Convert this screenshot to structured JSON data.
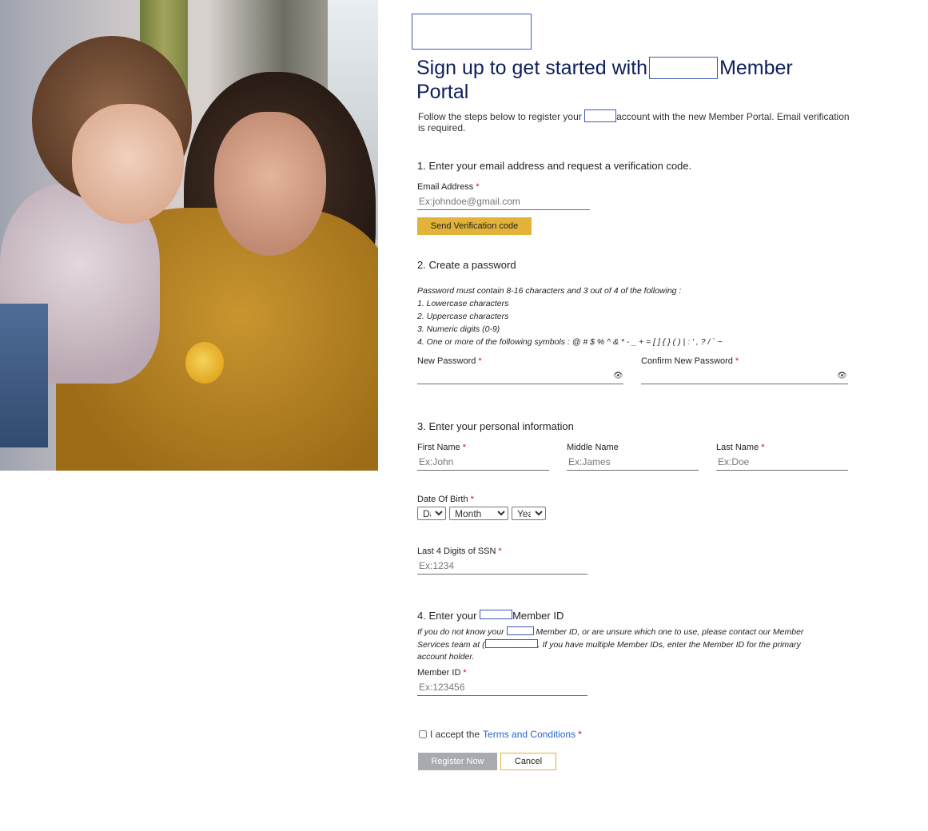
{
  "page": {
    "title_part1": "Sign up to get started with",
    "title_part2": "Member Portal",
    "subtitle_part1": "Follow the steps below to register your",
    "subtitle_part2": "account with the new Member Portal. Email verification is required."
  },
  "step1": {
    "heading": "1. Enter your email address and request a verification code.",
    "email_label": "Email Address",
    "email_placeholder": "Ex:johndoe@gmail.com",
    "send_button": "Send Verification code"
  },
  "step2": {
    "heading": "2. Create a password",
    "rules": [
      "Password must contain 8-16 characters and 3 out of 4 of the following :",
      "1. Lowercase characters",
      "2. Uppercase characters",
      "3. Numeric digits (0-9)",
      "4. One or more of the following symbols : @ # $ % ^ & * - _ + = [ ] { } ( ) | : ' , ? / ` ~"
    ],
    "new_password_label": "New Password",
    "confirm_password_label": "Confirm New Password",
    "eye_glyph": "👁"
  },
  "step3": {
    "heading": "3. Enter your personal information",
    "first_name_label": "First Name",
    "first_name_placeholder": "Ex:John",
    "middle_name_label": "Middle Name",
    "middle_name_placeholder": "Ex:James",
    "last_name_label": "Last Name",
    "last_name_placeholder": "Ex:Doe",
    "dob_label": "Date Of Birth",
    "dob_day": "Day",
    "dob_month": "Month",
    "dob_year": "Year",
    "ssn_label": "Last 4 Digits of SSN",
    "ssn_placeholder": "Ex:1234"
  },
  "step4": {
    "heading_part1": "4. Enter your",
    "heading_part2": "Member ID",
    "note_part1": "If you do not know your",
    "note_part2": "Member ID, or are unsure which one to use, please contact our Member Services team at (",
    "note_part3": ". If you have multiple Member IDs, enter the Member ID for the primary account holder.",
    "member_id_label": "Member ID",
    "member_id_placeholder": "Ex:123456"
  },
  "terms": {
    "text": "I accept the",
    "link": "Terms and Conditions"
  },
  "actions": {
    "register": "Register Now",
    "cancel": "Cancel"
  },
  "required_mark": "*",
  "colors": {
    "title": "#0d1f5c",
    "accent": "#e3b339",
    "required": "#c0141a",
    "link": "#2a66c9",
    "disabled_button": "#a7aaae"
  }
}
